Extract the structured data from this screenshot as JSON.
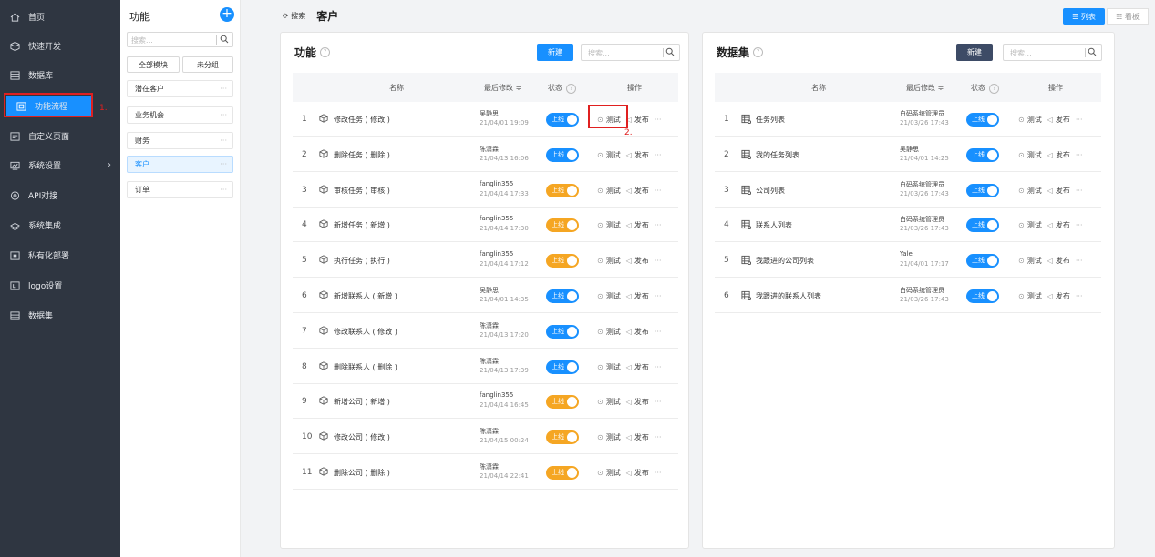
{
  "sidebar": {
    "items": [
      {
        "label": "首页",
        "icon": "home-icon"
      },
      {
        "label": "快速开发",
        "icon": "cube-icon"
      },
      {
        "label": "数据库",
        "icon": "database-icon"
      },
      {
        "label": "功能流程",
        "icon": "flow-icon",
        "active": true
      },
      {
        "label": "自定义页面",
        "icon": "page-icon"
      },
      {
        "label": "系统设置",
        "icon": "settings-icon",
        "arrow": "›"
      },
      {
        "label": "API对接",
        "icon": "api-icon"
      },
      {
        "label": "系统集成",
        "icon": "integration-icon"
      },
      {
        "label": "私有化部署",
        "icon": "deploy-icon"
      },
      {
        "label": "logo设置",
        "icon": "logo-icon"
      },
      {
        "label": "数据集",
        "icon": "dataset-icon"
      }
    ],
    "annotation_1": "1."
  },
  "modules": {
    "title": "功能",
    "add_label": "+",
    "search_placeholder": "搜索...",
    "tabs": [
      "全部模块",
      "未分组"
    ],
    "items": [
      {
        "label": "潜在客户"
      },
      {
        "label": "业务机会"
      },
      {
        "label": "财务"
      },
      {
        "label": "客户",
        "selected": true
      },
      {
        "label": "订单"
      }
    ],
    "dots": "···"
  },
  "header": {
    "search_label": "⟳ 搜索",
    "title": "客户",
    "view_list": "☰ 列表",
    "view_board": "☷ 看板"
  },
  "functions": {
    "title": "功能",
    "new_label": "新建",
    "search_placeholder": "搜索...",
    "columns": {
      "name": "名称",
      "modified": "最后修改 ≑",
      "status": "状态",
      "ops": "操作"
    },
    "toggle_label": "上线",
    "test_label": "测试",
    "publish_label": "发布",
    "more": "···",
    "annotation_2": "2.",
    "rows": [
      {
        "idx": "1",
        "name": "修改任务 ( 修改 )",
        "user": "吴静思",
        "time": "21/04/01 19:09",
        "status": "blue"
      },
      {
        "idx": "2",
        "name": "删除任务 ( 删除 )",
        "user": "陈潇霖",
        "time": "21/04/13 16:06",
        "status": "blue"
      },
      {
        "idx": "3",
        "name": "审核任务 ( 审核 )",
        "user": "fanglin355",
        "time": "21/04/14 17:33",
        "status": "orange"
      },
      {
        "idx": "4",
        "name": "新增任务 ( 新增 )",
        "user": "fanglin355",
        "time": "21/04/14 17:30",
        "status": "orange"
      },
      {
        "idx": "5",
        "name": "执行任务 ( 执行 )",
        "user": "fanglin355",
        "time": "21/04/14 17:12",
        "status": "orange"
      },
      {
        "idx": "6",
        "name": "新增联系人 ( 新增 )",
        "user": "吴静思",
        "time": "21/04/01 14:35",
        "status": "blue"
      },
      {
        "idx": "7",
        "name": "修改联系人 ( 修改 )",
        "user": "陈潇霖",
        "time": "21/04/13 17:20",
        "status": "blue"
      },
      {
        "idx": "8",
        "name": "删除联系人 ( 删除 )",
        "user": "陈潇霖",
        "time": "21/04/13 17:39",
        "status": "blue"
      },
      {
        "idx": "9",
        "name": "新增公司 ( 新增 )",
        "user": "fanglin355",
        "time": "21/04/14 16:45",
        "status": "orange"
      },
      {
        "idx": "10",
        "name": "修改公司 ( 修改 )",
        "user": "陈潇霖",
        "time": "21/04/15 00:24",
        "status": "orange"
      },
      {
        "idx": "11",
        "name": "删除公司 ( 删除 )",
        "user": "陈潇霖",
        "time": "21/04/14 22:41",
        "status": "orange"
      }
    ]
  },
  "datasets": {
    "title": "数据集",
    "new_label": "新建",
    "search_placeholder": "搜索...",
    "columns": {
      "name": "名称",
      "modified": "最后修改 ≑",
      "status": "状态",
      "ops": "操作"
    },
    "toggle_label": "上线",
    "test_label": "测试",
    "publish_label": "发布",
    "more": "···",
    "rows": [
      {
        "idx": "1",
        "name": "任务列表",
        "user": "白码系统管理员",
        "time": "21/03/26 17:43"
      },
      {
        "idx": "2",
        "name": "我的任务列表",
        "user": "吴静思",
        "time": "21/04/01 14:25"
      },
      {
        "idx": "3",
        "name": "公司列表",
        "user": "白码系统管理员",
        "time": "21/03/26 17:43"
      },
      {
        "idx": "4",
        "name": "联系人列表",
        "user": "白码系统管理员",
        "time": "21/03/26 17:43"
      },
      {
        "idx": "5",
        "name": "我跟进的公司列表",
        "user": "Yale",
        "time": "21/04/01 17:17"
      },
      {
        "idx": "6",
        "name": "我跟进的联系人列表",
        "user": "白码系统管理员",
        "time": "21/03/26 17:43"
      }
    ]
  },
  "colors": {
    "accent": "#1890ff",
    "orange": "#f5a623",
    "dark_btn": "#3d4b66",
    "sidebar_bg": "#2f3641",
    "annotation": "#e02020"
  }
}
